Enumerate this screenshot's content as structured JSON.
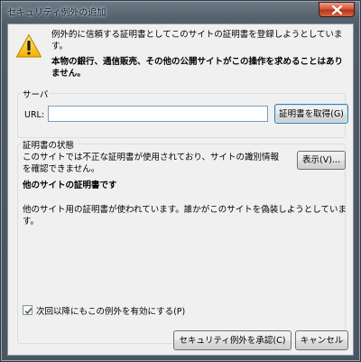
{
  "window": {
    "title": "セキュリティ例外の追加"
  },
  "warning": {
    "icon": "warning-triangle-icon",
    "text": "例外的に信頼する証明書としてこのサイトの証明書を登録しようとしています。",
    "bold_text": "本物の銀行、通信販売、その他の公開サイトがこの操作を求めることはありません。"
  },
  "server": {
    "group_label": "サーバ",
    "url_label": "URL:",
    "url_value": "",
    "get_cert_label": "証明書を取得(G)"
  },
  "cert_status": {
    "group_label": "証明書の状態",
    "text": "このサイトでは不正な証明書が使用されており、サイトの識別情報を確認できません。",
    "view_label": "表示(V)...",
    "bold_line": "他のサイトの証明書です",
    "detail": "他のサイト用の証明書が使われています。誰かがこのサイトを偽装しようとしています。"
  },
  "permanent": {
    "label": "次回以降にもこの例外を有効にする(P)",
    "checked": true
  },
  "buttons": {
    "confirm": "セキュリティ例外を承認(C)",
    "cancel": "キャンセル"
  }
}
